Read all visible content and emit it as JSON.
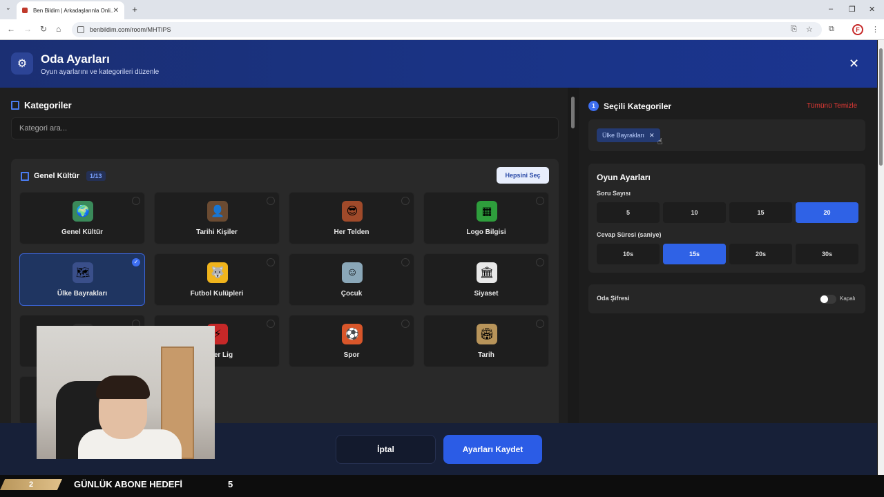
{
  "browser": {
    "tab_title": "Ben Bildim | Arkadaşlarınla Onli...",
    "url": "benbildim.com/room/MHTIPS"
  },
  "modal": {
    "title": "Oda Ayarları",
    "subtitle": "Oyun ayarlarını ve kategorileri düzenle"
  },
  "categories": {
    "section_title": "Kategoriler",
    "search_placeholder": "Kategori ara...",
    "group_title": "Genel Kültür",
    "group_count": "1/13",
    "select_all": "Hepsini Seç",
    "items": [
      {
        "label": "Genel Kültür",
        "icon": "globe-icon",
        "color": "#3a8a5a"
      },
      {
        "label": "Tarihi Kişiler",
        "icon": "portrait-icon",
        "color": "#6b4b32"
      },
      {
        "label": "Her Telden",
        "icon": "person-icon",
        "color": "#a04a2a"
      },
      {
        "label": "Logo Bilgisi",
        "icon": "logo-icon",
        "color": "#2e9e3c"
      },
      {
        "label": "Ülke Bayrakları",
        "icon": "flag-globe-icon",
        "color": "#3a4f8a"
      },
      {
        "label": "Futbol Kulüpleri",
        "icon": "wolf-crest-icon",
        "color": "#f0b41c"
      },
      {
        "label": "Çocuk",
        "icon": "child-icon",
        "color": "#8aa7b8"
      },
      {
        "label": "Siyaset",
        "icon": "building-icon",
        "color": "#e8e8e8"
      },
      {
        "label": "",
        "icon": "hidden-icon",
        "color": "#2a2a2a"
      },
      {
        "label": "Süper Lig",
        "icon": "league-icon",
        "color": "#c62828"
      },
      {
        "label": "Spor",
        "icon": "ball-icon",
        "color": "#d8562a"
      },
      {
        "label": "Tarih",
        "icon": "colosseum-icon",
        "color": "#b8945a"
      }
    ]
  },
  "selected": {
    "count": "1",
    "title": "Seçili Kategoriler",
    "clear_all": "Tümünü Temizle",
    "chips": [
      "Ülke Bayrakları"
    ]
  },
  "game_settings": {
    "title": "Oyun Ayarları",
    "question_label": "Soru Sayısı",
    "question_options": [
      "5",
      "10",
      "15",
      "20"
    ],
    "question_selected": "20",
    "time_label": "Cevap Süresi (saniye)",
    "time_options": [
      "10s",
      "15s",
      "20s",
      "30s"
    ],
    "time_selected": "15s"
  },
  "password": {
    "label": "Oda Şifresi",
    "state": "Kapalı"
  },
  "footer": {
    "cancel": "İptal",
    "save": "Ayarları Kaydet"
  },
  "stream": {
    "current": "2",
    "text": "GÜNLÜK ABONE HEDEFİ",
    "target": "5"
  }
}
